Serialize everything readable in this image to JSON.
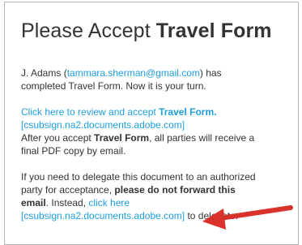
{
  "email": {
    "title_prefix": "Please Accept ",
    "title_doc": "Travel Form",
    "p1": {
      "sender": "J. Adams (",
      "sender_email": "tammara.sherman@gmail.com",
      "after_email": ") has",
      "line2": "completed Travel Form. Now it is your turn."
    },
    "p2": {
      "review_link": "Click here to review and accept ",
      "review_link_doc": "Travel Form.",
      "review_url": "[csubsign.na2.documents.adobe.com]",
      "after_prefix": "After you accept ",
      "after_doc": "Travel Form",
      "after_suffix": ", all parties will receive a",
      "line4": "final PDF copy by email."
    },
    "p3": {
      "line1": "If you need to delegate this document to an authorized",
      "line2_prefix": "party for acceptance, ",
      "line2_bold": "please do not forward this",
      "line3_bold": "email",
      "line3_mid": ". Instead, ",
      "line3_link": "click here",
      "delegate_url": "[csubsign.na2.documents.adobe.com]",
      "line4_suffix": " to delegate."
    }
  },
  "colors": {
    "link": "#1c9de0",
    "text": "#333333",
    "arrow": "#d9312c",
    "border": "#b5b5b5"
  },
  "icons": {
    "annotation": "red-arrow-icon"
  }
}
